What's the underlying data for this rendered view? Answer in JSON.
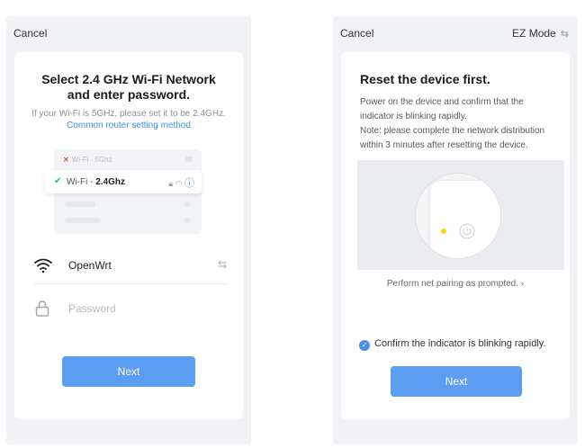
{
  "left": {
    "cancel": "Cancel",
    "title_line1": "Select 2.4 GHz Wi-Fi Network",
    "title_line2": "and enter password.",
    "subtitle": "If your Wi-Fi is 5GHz, please set it to be 2.4GHz.",
    "router_link": "Common router setting method",
    "illustration": {
      "rejected_network": "Wi-Fi - 5Ghz",
      "selected_prefix": "Wi-Fi -",
      "selected_network": "2.4Ghz"
    },
    "wifi_name": "OpenWrt",
    "password_placeholder": "Password",
    "next": "Next"
  },
  "right": {
    "cancel": "Cancel",
    "mode": "EZ Mode",
    "title": "Reset the device first.",
    "body_line1": "Power on the device and confirm that the",
    "body_line2": "indicator is blinking rapidly.",
    "body_line3": "Note: please complete the network distribution",
    "body_line4": "within 3 minutes after resetting the device.",
    "hint": "Perform net pairing as prompted. ›",
    "confirm": "Confirm the indicator is blinking rapidly.",
    "confirm_checked": true,
    "next": "Next"
  },
  "colors": {
    "accent": "#5c9ef2",
    "link": "#3a8ff0",
    "background": "#f1f2f6",
    "led": "#f5d416"
  },
  "icons": {
    "wifi": "wifi-icon",
    "lock": "lock-icon",
    "swap": "swap-icon",
    "power": "power-icon",
    "check": "check-icon"
  }
}
